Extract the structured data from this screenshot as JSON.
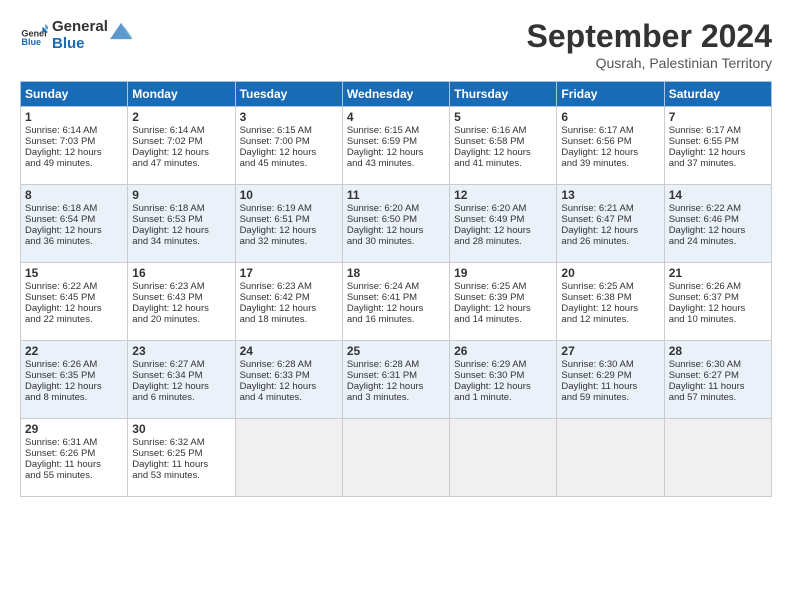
{
  "header": {
    "logo_line1": "General",
    "logo_line2": "Blue",
    "month": "September 2024",
    "location": "Qusrah, Palestinian Territory"
  },
  "days_of_week": [
    "Sunday",
    "Monday",
    "Tuesday",
    "Wednesday",
    "Thursday",
    "Friday",
    "Saturday"
  ],
  "weeks": [
    [
      {
        "day": 1,
        "lines": [
          "Sunrise: 6:14 AM",
          "Sunset: 7:03 PM",
          "Daylight: 12 hours",
          "and 49 minutes."
        ]
      },
      {
        "day": 2,
        "lines": [
          "Sunrise: 6:14 AM",
          "Sunset: 7:02 PM",
          "Daylight: 12 hours",
          "and 47 minutes."
        ]
      },
      {
        "day": 3,
        "lines": [
          "Sunrise: 6:15 AM",
          "Sunset: 7:00 PM",
          "Daylight: 12 hours",
          "and 45 minutes."
        ]
      },
      {
        "day": 4,
        "lines": [
          "Sunrise: 6:15 AM",
          "Sunset: 6:59 PM",
          "Daylight: 12 hours",
          "and 43 minutes."
        ]
      },
      {
        "day": 5,
        "lines": [
          "Sunrise: 6:16 AM",
          "Sunset: 6:58 PM",
          "Daylight: 12 hours",
          "and 41 minutes."
        ]
      },
      {
        "day": 6,
        "lines": [
          "Sunrise: 6:17 AM",
          "Sunset: 6:56 PM",
          "Daylight: 12 hours",
          "and 39 minutes."
        ]
      },
      {
        "day": 7,
        "lines": [
          "Sunrise: 6:17 AM",
          "Sunset: 6:55 PM",
          "Daylight: 12 hours",
          "and 37 minutes."
        ]
      }
    ],
    [
      {
        "day": 8,
        "lines": [
          "Sunrise: 6:18 AM",
          "Sunset: 6:54 PM",
          "Daylight: 12 hours",
          "and 36 minutes."
        ]
      },
      {
        "day": 9,
        "lines": [
          "Sunrise: 6:18 AM",
          "Sunset: 6:53 PM",
          "Daylight: 12 hours",
          "and 34 minutes."
        ]
      },
      {
        "day": 10,
        "lines": [
          "Sunrise: 6:19 AM",
          "Sunset: 6:51 PM",
          "Daylight: 12 hours",
          "and 32 minutes."
        ]
      },
      {
        "day": 11,
        "lines": [
          "Sunrise: 6:20 AM",
          "Sunset: 6:50 PM",
          "Daylight: 12 hours",
          "and 30 minutes."
        ]
      },
      {
        "day": 12,
        "lines": [
          "Sunrise: 6:20 AM",
          "Sunset: 6:49 PM",
          "Daylight: 12 hours",
          "and 28 minutes."
        ]
      },
      {
        "day": 13,
        "lines": [
          "Sunrise: 6:21 AM",
          "Sunset: 6:47 PM",
          "Daylight: 12 hours",
          "and 26 minutes."
        ]
      },
      {
        "day": 14,
        "lines": [
          "Sunrise: 6:22 AM",
          "Sunset: 6:46 PM",
          "Daylight: 12 hours",
          "and 24 minutes."
        ]
      }
    ],
    [
      {
        "day": 15,
        "lines": [
          "Sunrise: 6:22 AM",
          "Sunset: 6:45 PM",
          "Daylight: 12 hours",
          "and 22 minutes."
        ]
      },
      {
        "day": 16,
        "lines": [
          "Sunrise: 6:23 AM",
          "Sunset: 6:43 PM",
          "Daylight: 12 hours",
          "and 20 minutes."
        ]
      },
      {
        "day": 17,
        "lines": [
          "Sunrise: 6:23 AM",
          "Sunset: 6:42 PM",
          "Daylight: 12 hours",
          "and 18 minutes."
        ]
      },
      {
        "day": 18,
        "lines": [
          "Sunrise: 6:24 AM",
          "Sunset: 6:41 PM",
          "Daylight: 12 hours",
          "and 16 minutes."
        ]
      },
      {
        "day": 19,
        "lines": [
          "Sunrise: 6:25 AM",
          "Sunset: 6:39 PM",
          "Daylight: 12 hours",
          "and 14 minutes."
        ]
      },
      {
        "day": 20,
        "lines": [
          "Sunrise: 6:25 AM",
          "Sunset: 6:38 PM",
          "Daylight: 12 hours",
          "and 12 minutes."
        ]
      },
      {
        "day": 21,
        "lines": [
          "Sunrise: 6:26 AM",
          "Sunset: 6:37 PM",
          "Daylight: 12 hours",
          "and 10 minutes."
        ]
      }
    ],
    [
      {
        "day": 22,
        "lines": [
          "Sunrise: 6:26 AM",
          "Sunset: 6:35 PM",
          "Daylight: 12 hours",
          "and 8 minutes."
        ]
      },
      {
        "day": 23,
        "lines": [
          "Sunrise: 6:27 AM",
          "Sunset: 6:34 PM",
          "Daylight: 12 hours",
          "and 6 minutes."
        ]
      },
      {
        "day": 24,
        "lines": [
          "Sunrise: 6:28 AM",
          "Sunset: 6:33 PM",
          "Daylight: 12 hours",
          "and 4 minutes."
        ]
      },
      {
        "day": 25,
        "lines": [
          "Sunrise: 6:28 AM",
          "Sunset: 6:31 PM",
          "Daylight: 12 hours",
          "and 3 minutes."
        ]
      },
      {
        "day": 26,
        "lines": [
          "Sunrise: 6:29 AM",
          "Sunset: 6:30 PM",
          "Daylight: 12 hours",
          "and 1 minute."
        ]
      },
      {
        "day": 27,
        "lines": [
          "Sunrise: 6:30 AM",
          "Sunset: 6:29 PM",
          "Daylight: 11 hours",
          "and 59 minutes."
        ]
      },
      {
        "day": 28,
        "lines": [
          "Sunrise: 6:30 AM",
          "Sunset: 6:27 PM",
          "Daylight: 11 hours",
          "and 57 minutes."
        ]
      }
    ],
    [
      {
        "day": 29,
        "lines": [
          "Sunrise: 6:31 AM",
          "Sunset: 6:26 PM",
          "Daylight: 11 hours",
          "and 55 minutes."
        ]
      },
      {
        "day": 30,
        "lines": [
          "Sunrise: 6:32 AM",
          "Sunset: 6:25 PM",
          "Daylight: 11 hours",
          "and 53 minutes."
        ]
      },
      null,
      null,
      null,
      null,
      null
    ]
  ]
}
